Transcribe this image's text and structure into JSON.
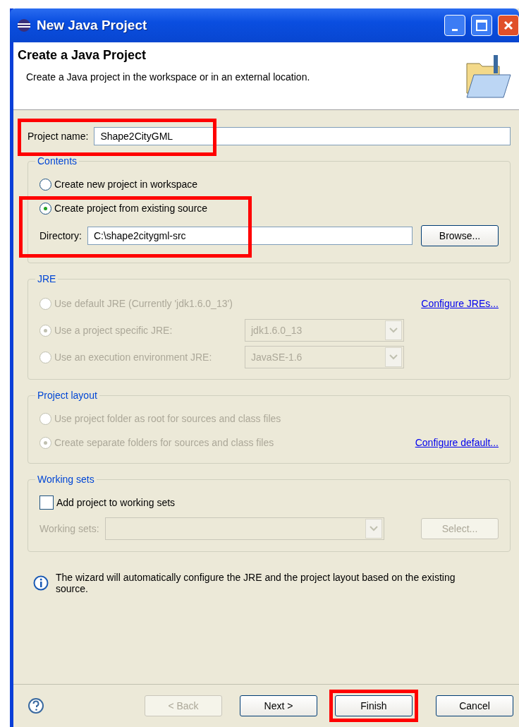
{
  "window": {
    "title": "New Java Project"
  },
  "header": {
    "title": "Create a Java Project",
    "description": "Create a Java project in the workspace or in an external location."
  },
  "project_name": {
    "label": "Project name:",
    "value": "Shape2CityGML",
    "highlighted": true
  },
  "contents": {
    "title": "Contents",
    "highlighted": true,
    "options": [
      {
        "label": "Create new project in workspace",
        "selected": false
      },
      {
        "label": "Create project from existing source",
        "selected": true
      }
    ],
    "directory": {
      "label": "Directory:",
      "value": "C:\\shape2citygml-src",
      "button": "Browse..."
    }
  },
  "jre": {
    "title": "JRE",
    "disabled": true,
    "rows": [
      {
        "label": "Use default JRE (Currently 'jdk1.6.0_13')",
        "selected": false,
        "link": "Configure JREs..."
      },
      {
        "label": "Use a project specific JRE:",
        "selected": true,
        "dropdown": "jdk1.6.0_13"
      },
      {
        "label": "Use an execution environment JRE:",
        "selected": false,
        "dropdown": "JavaSE-1.6"
      }
    ]
  },
  "project_layout": {
    "title": "Project layout",
    "disabled": true,
    "rows": [
      {
        "label": "Use project folder as root for sources and class files",
        "selected": false
      },
      {
        "label": "Create separate folders for sources and class files",
        "selected": true,
        "link": "Configure default..."
      }
    ]
  },
  "working_sets": {
    "title": "Working sets",
    "checkbox": {
      "label": "Add project to working sets",
      "checked": false
    },
    "field_label": "Working sets:",
    "disabled": true,
    "button": "Select..."
  },
  "info": "The wizard will automatically configure the JRE and the project layout based on the existing source.",
  "buttons": [
    {
      "label": "< Back",
      "disabled": true,
      "highlighted": false
    },
    {
      "label": "Next >",
      "disabled": false,
      "highlighted": false
    },
    {
      "label": "Finish",
      "disabled": false,
      "highlighted": true
    },
    {
      "label": "Cancel",
      "disabled": false,
      "highlighted": false
    }
  ]
}
